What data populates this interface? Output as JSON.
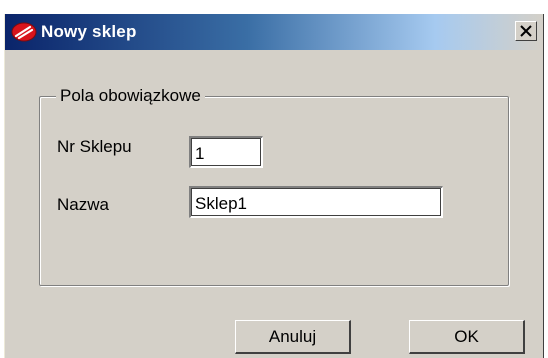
{
  "window": {
    "title": "Nowy sklep",
    "icon": "app-logo-icon",
    "close_icon": "close-icon",
    "close_symbol": "×"
  },
  "group": {
    "legend": "Pola obowiązkowe",
    "fields": [
      {
        "label": "Nr Sklepu",
        "value": "1"
      },
      {
        "label": "Nazwa",
        "value": "Sklep1"
      }
    ]
  },
  "buttons": {
    "cancel_label": "Anuluj",
    "ok_label": "OK"
  },
  "colors": {
    "titlebar_start": "#0a246a",
    "titlebar_end": "#a6caf0",
    "face": "#d4d0c8",
    "icon_red": "#d8141c"
  }
}
